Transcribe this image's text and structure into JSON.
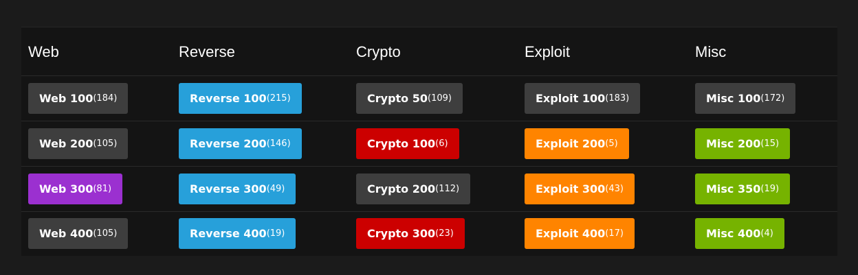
{
  "colors": {
    "page_bg": "#1b1b1b",
    "panel_bg": "#141414",
    "unsolved": "#3e3e3e",
    "reverse": "#27a0da",
    "red": "#cc0000",
    "orange": "#ff8400",
    "green": "#76b300",
    "purple": "#9b30d0"
  },
  "categories": [
    "Web",
    "Reverse",
    "Crypto",
    "Exploit",
    "Misc"
  ],
  "columns": [
    {
      "category": "Web",
      "challenges": [
        {
          "name": "Web 100",
          "solves": "(184)",
          "color": "#3e3e3e"
        },
        {
          "name": "Web 200",
          "solves": "(105)",
          "color": "#3e3e3e"
        },
        {
          "name": "Web 300",
          "solves": "(81)",
          "color": "#9b30d0"
        },
        {
          "name": "Web 400",
          "solves": "(105)",
          "color": "#3e3e3e"
        }
      ]
    },
    {
      "category": "Reverse",
      "challenges": [
        {
          "name": "Reverse 100",
          "solves": "(215)",
          "color": "#27a0da"
        },
        {
          "name": "Reverse 200",
          "solves": "(146)",
          "color": "#27a0da"
        },
        {
          "name": "Reverse 300",
          "solves": "(49)",
          "color": "#27a0da"
        },
        {
          "name": "Reverse 400",
          "solves": "(19)",
          "color": "#27a0da"
        }
      ]
    },
    {
      "category": "Crypto",
      "challenges": [
        {
          "name": "Crypto 50",
          "solves": "(109)",
          "color": "#3e3e3e"
        },
        {
          "name": "Crypto 100",
          "solves": "(6)",
          "color": "#cc0000"
        },
        {
          "name": "Crypto 200",
          "solves": "(112)",
          "color": "#3e3e3e"
        },
        {
          "name": "Crypto 300",
          "solves": "(23)",
          "color": "#cc0000"
        }
      ]
    },
    {
      "category": "Exploit",
      "challenges": [
        {
          "name": "Exploit 100",
          "solves": "(183)",
          "color": "#3e3e3e"
        },
        {
          "name": "Exploit 200",
          "solves": "(5)",
          "color": "#ff8400"
        },
        {
          "name": "Exploit 300",
          "solves": "(43)",
          "color": "#ff8400"
        },
        {
          "name": "Exploit 400",
          "solves": "(17)",
          "color": "#ff8400"
        }
      ]
    },
    {
      "category": "Misc",
      "challenges": [
        {
          "name": "Misc 100",
          "solves": "(172)",
          "color": "#3e3e3e"
        },
        {
          "name": "Misc 200",
          "solves": "(15)",
          "color": "#76b300"
        },
        {
          "name": "Misc 350",
          "solves": "(19)",
          "color": "#76b300"
        },
        {
          "name": "Misc 400",
          "solves": "(4)",
          "color": "#76b300"
        }
      ]
    }
  ]
}
